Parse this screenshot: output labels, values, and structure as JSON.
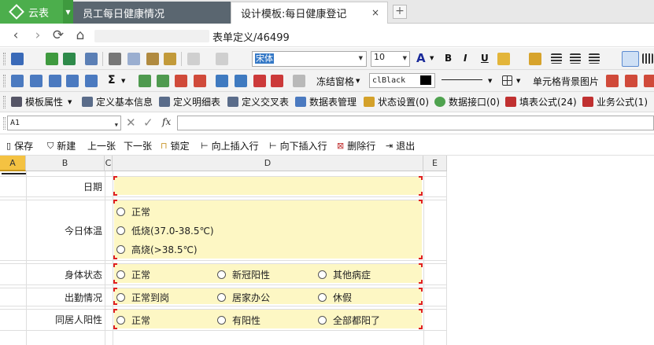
{
  "app": {
    "name": "云表"
  },
  "tabs": [
    {
      "label": "员工每日健康情况"
    },
    {
      "label": "设计模板:每日健康登记",
      "close": "×"
    }
  ],
  "tab_add": "+",
  "nav": {
    "page_title": "表单定义/46499"
  },
  "toolbar1": {
    "font": "宋体",
    "size": "10",
    "bold": "B",
    "italic": "I",
    "underline": "U",
    "font_color_label": "A"
  },
  "toolbar2": {
    "sigma": "Σ",
    "freeze": "冻结窗格",
    "color": "clBlack",
    "bg_image": "单元格背景图片"
  },
  "toolbar3": [
    "模板属性",
    "定义基本信息",
    "定义明细表",
    "定义交叉表",
    "数据表管理",
    "状态设置(0)",
    "数据接口(0)",
    "填表公式(24)",
    "业务公式(1)"
  ],
  "formula_bar": {
    "cell_ref": "A1",
    "fx": "fx",
    "value": ""
  },
  "actions": [
    "保存",
    "新建",
    "上一张",
    "下一张",
    "锁定",
    "向上插入行",
    "向下插入行",
    "删除行",
    "退出"
  ],
  "columns": [
    "A",
    "B",
    "C",
    "D",
    "E"
  ],
  "form": {
    "date_label": "日期",
    "temp_label": "今日体温",
    "temp_options": [
      "正常",
      "低烧(37.0-38.5℃)",
      "高烧(>38.5℃)"
    ],
    "body_label": "身体状态",
    "body_options": [
      "正常",
      "新冠阳性",
      "其他病症"
    ],
    "attend_label": "出勤情况",
    "attend_options": [
      "正常到岗",
      "居家办公",
      "休假"
    ],
    "cohab_label": "同居人阳性",
    "cohab_options": [
      "正常",
      "有阳性",
      "全部都阳了"
    ]
  },
  "colors": {
    "brand": "#4cae4c",
    "field_bg": "#fdf7c4",
    "field_corner": "#e02020",
    "active_col": "#f4c242"
  }
}
